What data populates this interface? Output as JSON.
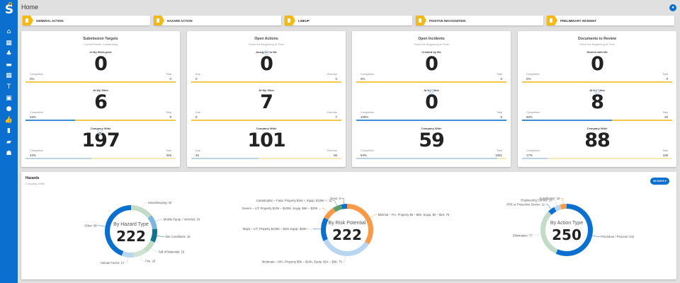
{
  "header": {
    "title": "Home",
    "user_icon": "user-circle-icon"
  },
  "sidebar": {
    "logo": "S",
    "items": [
      {
        "icon": "home-icon",
        "glyph": "⌂"
      },
      {
        "icon": "calendar-icon",
        "glyph": "▦"
      },
      {
        "icon": "sitemap-icon",
        "glyph": "♣"
      },
      {
        "icon": "folder-open-icon",
        "glyph": "▬"
      },
      {
        "icon": "table-icon",
        "glyph": "▦"
      },
      {
        "icon": "tools-icon",
        "glyph": "T"
      },
      {
        "icon": "id-card-icon",
        "glyph": "▣"
      },
      {
        "icon": "lightbulb-icon",
        "glyph": "●"
      },
      {
        "icon": "thumbs-up-icon",
        "glyph": "👍"
      },
      {
        "icon": "file-icon",
        "glyph": "▮"
      },
      {
        "icon": "toolbox-icon",
        "glyph": "▰"
      },
      {
        "icon": "users-icon",
        "glyph": "☗"
      }
    ]
  },
  "actions": [
    "GENERAL ACTION",
    "HAZARD ACTION",
    "LINEUP",
    "POSITIVE RECOGNITION",
    "PRELIMINARY INCIDENT"
  ],
  "colors": {
    "accent": "#0b6fcf",
    "tag": "#f4b916",
    "bar_fill": "#3a8ed3",
    "bar_rest": "#f1c94f"
  },
  "cards": [
    {
      "title": "Submission Targets",
      "subtitle": "Current Month Outstanding",
      "sections": [
        {
          "label": "In My Work-pool",
          "value": "0",
          "left_label": "Completion",
          "left_value": "0%",
          "right_label": "Total",
          "right_value": "0",
          "progress": 0
        },
        {
          "label": "At My Sites",
          "value": "6",
          "left_label": "Completion",
          "left_value": "33%",
          "right_label": "Total",
          "right_value": "9",
          "progress": 33
        },
        {
          "label": "Company Wide",
          "value": "197",
          "left_label": "Completion",
          "left_value": "44%",
          "right_label": "Total",
          "right_value": "349",
          "progress": 44
        }
      ]
    },
    {
      "title": "Open Actions",
      "subtitle": "Since the Beginning of Time",
      "sections": [
        {
          "label": "Assigned to Me",
          "value": "0",
          "left_label": "Due",
          "left_value": "0",
          "right_label": "Overdue",
          "right_value": "0",
          "progress": 0
        },
        {
          "label": "At My Sites",
          "value": "7",
          "left_label": "Due",
          "left_value": "0",
          "right_label": "Overdue",
          "right_value": "7",
          "progress": 0
        },
        {
          "label": "Company Wide",
          "value": "101",
          "left_label": "Due",
          "left_value": "45",
          "right_label": "Overdue",
          "right_value": "56",
          "progress": 45
        }
      ]
    },
    {
      "title": "Open Incidents",
      "subtitle": "Since the Beginning of Time",
      "sections": [
        {
          "label": "Created by Me",
          "value": "0",
          "left_label": "Completion",
          "left_value": "0%",
          "right_label": "Total",
          "right_value": "0",
          "progress": 0
        },
        {
          "label": "At My Sites",
          "value": "0",
          "left_label": "Completion",
          "left_value": "100%",
          "right_label": "Total",
          "right_value": "6",
          "progress": 100
        },
        {
          "label": "Company Wide",
          "value": "59",
          "left_label": "Completion",
          "left_value": "94%",
          "right_label": "Total",
          "right_value": "1061",
          "progress": 94
        }
      ]
    },
    {
      "title": "Documents to Review",
      "subtitle": "Since the Beginning of Time",
      "sections": [
        {
          "label": "Shared with Me",
          "value": "0",
          "left_label": "Completion",
          "left_value": "0%",
          "right_label": "Total",
          "right_value": "0",
          "progress": 0
        },
        {
          "label": "At My Sites",
          "value": "8",
          "left_label": "Completion",
          "left_value": "60%",
          "right_label": "Total",
          "right_value": "20",
          "progress": 60
        },
        {
          "label": "Company Wide",
          "value": "88",
          "left_label": "Completion",
          "left_value": "17%",
          "right_label": "Total",
          "right_value": "106",
          "progress": 17
        }
      ]
    }
  ],
  "hazards": {
    "title": "Hazards",
    "subtitle": "Company Wide",
    "range_button": "90 DAYS ▾"
  },
  "chart_data": [
    {
      "type": "pie",
      "title": "By Hazard Type",
      "total": "222",
      "slices": [
        {
          "label": "Housekeeping: 32",
          "value": 32,
          "color": "#c3dcc8"
        },
        {
          "label": "Mobile Equip. / Vehicles: 20",
          "value": 20,
          "color": "#7fb6e0"
        },
        {
          "label": "Site Conditions: 19",
          "value": 19,
          "color": "#0e7490"
        },
        {
          "label": "Fall of Materials: 18",
          "value": 18,
          "color": "#c3dcc8"
        },
        {
          "label": "Fire: 18",
          "value": 18,
          "color": "#cfe3d2"
        },
        {
          "label": "Human Factor: 17",
          "value": 17,
          "color": "#b9d6f0"
        },
        {
          "label": "Other: 98",
          "value": 98,
          "color": "#0b6fcf"
        }
      ]
    },
    {
      "type": "pie",
      "title": "By Risk Potential",
      "total": "222",
      "slices": [
        {
          "label": "Minimal – F/A, Property $0 – $5K, Equip. $0 – $1K: 76",
          "value": 76,
          "color": "#f79a4a"
        },
        {
          "label": "Moderate – M/A, Property $5K – $10K, Equip. $1K – $5K: 75",
          "value": 75,
          "color": "#b9d6f0"
        },
        {
          "label": "Major – L/T, Property $100K – $1M, Equip. $20K – ...",
          "value": 33,
          "color": "#0b6fcf"
        },
        {
          "label": "Severe – L/T, Property $10K – $100K, Equip. $5K – $20K ...",
          "value": 18,
          "color": "#f79a4a"
        },
        {
          "label": "Catastrophic – Fatal, Property $1M +, Equip. $100K +: 12",
          "value": 12,
          "color": "#5b9e6a"
        },
        {
          "label": "None: 8",
          "value": 8,
          "color": "#0b6fcf"
        }
      ]
    },
    {
      "type": "pie",
      "title": "By Action Type",
      "total": "250",
      "slices": [
        {
          "label": "Procedure / Process: 142",
          "value": 142,
          "color": "#0b6fcf"
        },
        {
          "label": "Elimination: 77",
          "value": 77,
          "color": "#c3dcc8"
        },
        {
          "label": "PPE or Protective Device: 11",
          "value": 11,
          "color": "#0b6fcf"
        },
        {
          "label": "Engineering Control: 10",
          "value": 10,
          "color": "#b9d6f0"
        },
        {
          "label": "Substitution: 10",
          "value": 10,
          "color": "#f79a4a"
        }
      ]
    }
  ]
}
